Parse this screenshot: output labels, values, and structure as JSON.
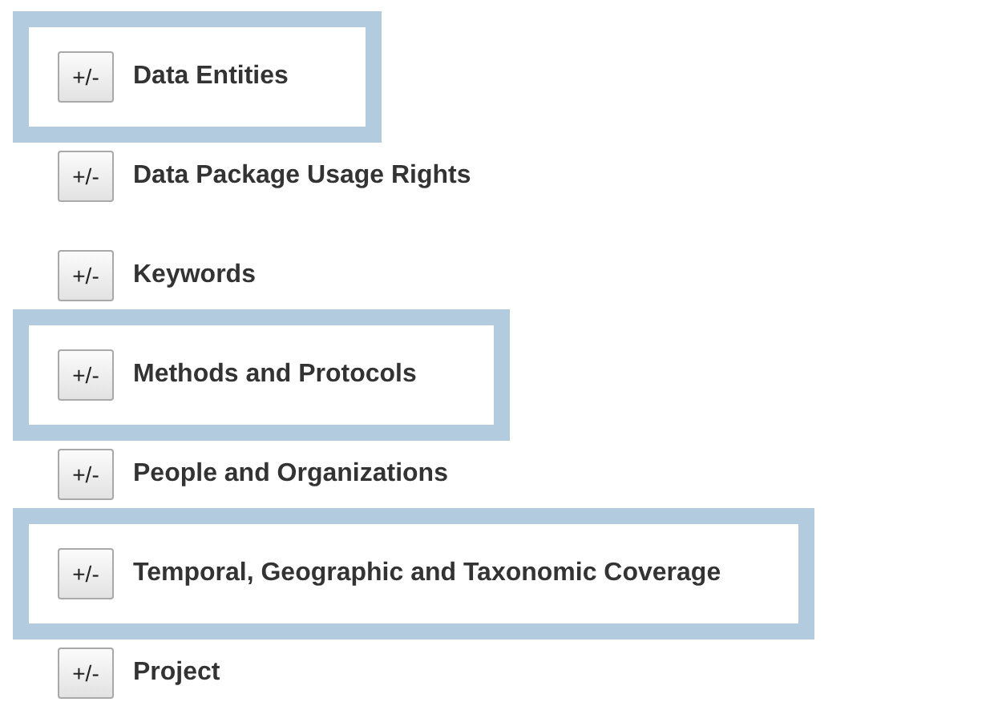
{
  "sections": [
    {
      "button": "+/-",
      "label": "Data Entities",
      "highlighted": true
    },
    {
      "button": "+/-",
      "label": "Data Package Usage Rights",
      "highlighted": false
    },
    {
      "button": "+/-",
      "label": "Keywords",
      "highlighted": false
    },
    {
      "button": "+/-",
      "label": "Methods and Protocols",
      "highlighted": true
    },
    {
      "button": "+/-",
      "label": "People and Organizations",
      "highlighted": false
    },
    {
      "button": "+/-",
      "label": "Temporal, Geographic and Taxonomic Coverage",
      "highlighted": true
    },
    {
      "button": "+/-",
      "label": "Project",
      "highlighted": false
    }
  ]
}
